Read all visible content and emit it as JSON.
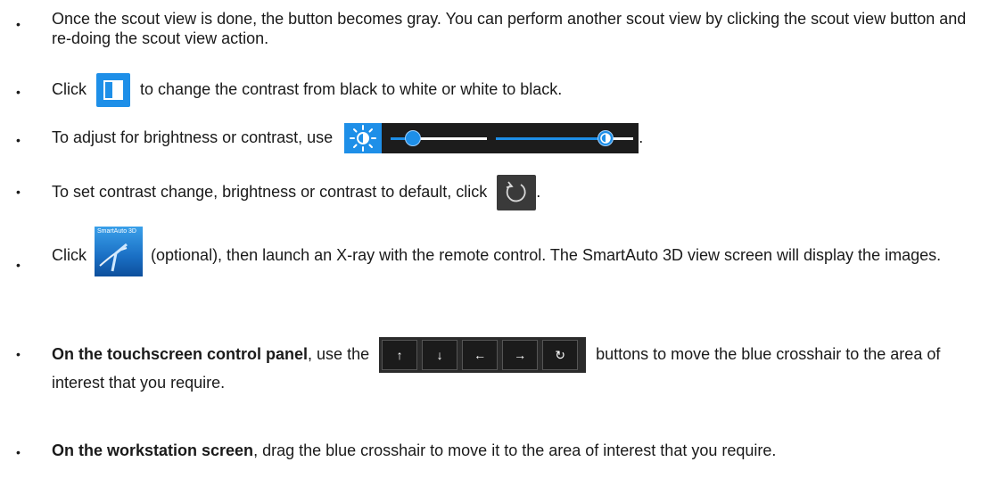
{
  "items": [
    {
      "text": "Once the scout view is done, the button becomes gray. You can perform another scout view by clicking the scout view button and re-doing the scout view action."
    },
    {
      "before": "Click",
      "after": " to change the contrast from black to white or white to black."
    },
    {
      "before": "To adjust for brightness or contrast, use",
      "after": "."
    },
    {
      "before": "To set contrast change, brightness or contrast to default, click",
      "after": "."
    },
    {
      "before": "Click",
      "after": " (optional), then launch an X-ray with the remote control. The SmartAuto 3D view screen will display the images.",
      "icon_label": "SmartAuto 3D"
    },
    {
      "bold": "On the touchscreen control panel",
      "before": ", use the",
      "after": " buttons to move the blue crosshair to the area of interest that you require."
    },
    {
      "bold": "On the workstation screen",
      "after": ", drag the blue crosshair to move it to the area of interest that you require."
    }
  ],
  "bullet": "•",
  "brightness_level": 0.12,
  "contrast_level": 0.85,
  "colors": {
    "accent": "#1e8fe8",
    "dark_panel": "#1c1c1c"
  },
  "arrow_icons": [
    "↑",
    "↓",
    "←",
    "→",
    "↻"
  ]
}
